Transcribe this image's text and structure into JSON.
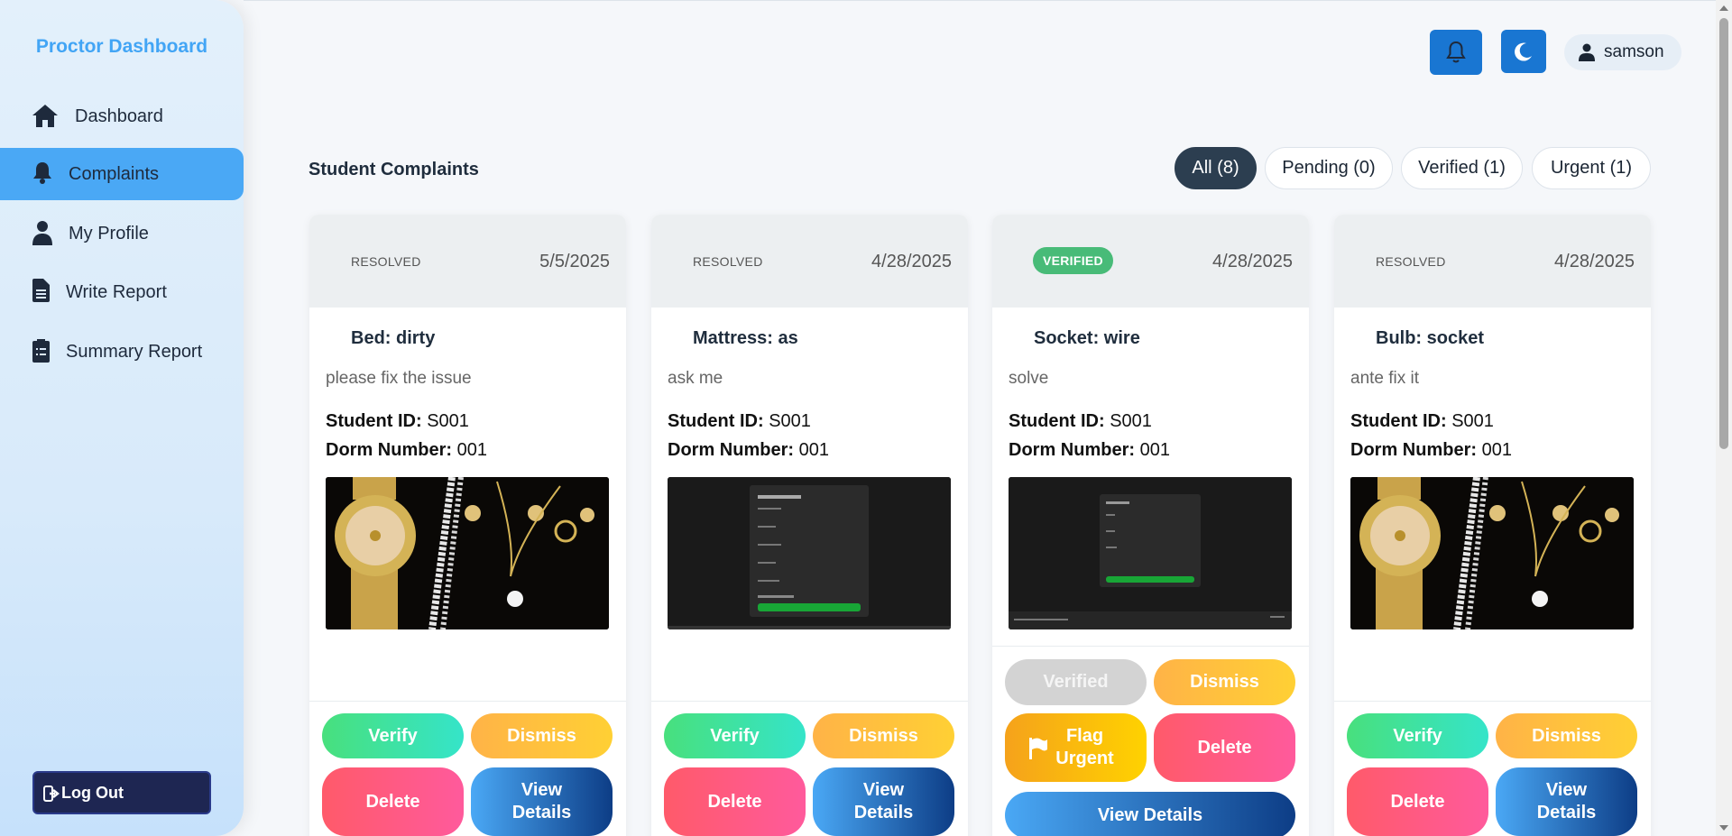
{
  "sidebar": {
    "brand": "Proctor Dashboard",
    "items": [
      {
        "label": "Dashboard",
        "icon": "home-icon"
      },
      {
        "label": "Complaints",
        "icon": "bell-icon",
        "active": true
      },
      {
        "label": "My Profile",
        "icon": "user-icon"
      },
      {
        "label": "Write Report",
        "icon": "file-icon"
      },
      {
        "label": "Summary Report",
        "icon": "clipboard-icon"
      }
    ],
    "logout_label": "Log Out"
  },
  "header": {
    "notifications_icon": "bell-icon",
    "theme_icon": "moon-icon",
    "user_name": "samson"
  },
  "main": {
    "title": "Student Complaints",
    "filters": [
      {
        "label": "All (8)",
        "active": true
      },
      {
        "label": "Pending (0)"
      },
      {
        "label": "Verified (1)"
      },
      {
        "label": "Urgent (1)"
      }
    ],
    "cards": [
      {
        "status": "RESOLVED",
        "date": "5/5/2025",
        "title": "Bed: dirty",
        "description": "please fix the issue",
        "student_id_label": "Student ID:",
        "student_id": "S001",
        "dorm_label": "Dorm Number:",
        "dorm": "001",
        "image": "jewelry-photo",
        "buttons": {
          "verify": "Verify",
          "dismiss": "Dismiss",
          "delete": "Delete",
          "view": "View Details"
        }
      },
      {
        "status": "RESOLVED",
        "date": "4/28/2025",
        "title": "Mattress: as",
        "description": "ask me",
        "student_id_label": "Student ID:",
        "student_id": "S001",
        "dorm_label": "Dorm Number:",
        "dorm": "001",
        "image": "create-account-screenshot",
        "buttons": {
          "verify": "Verify",
          "dismiss": "Dismiss",
          "delete": "Delete",
          "view": "View Details"
        }
      },
      {
        "status": "VERIFIED",
        "date": "4/28/2025",
        "title": "Socket: wire",
        "description": "solve",
        "student_id_label": "Student ID:",
        "student_id": "S001",
        "dorm_label": "Dorm Number:",
        "dorm": "001",
        "image": "contact-form-screenshot",
        "buttons": {
          "verified": "Verified",
          "dismiss": "Dismiss",
          "urgent": "Flag Urgent",
          "delete": "Delete",
          "view": "View Details"
        }
      },
      {
        "status": "RESOLVED",
        "date": "4/28/2025",
        "title": "Bulb: socket",
        "description": "ante fix it",
        "student_id_label": "Student ID:",
        "student_id": "S001",
        "dorm_label": "Dorm Number:",
        "dorm": "001",
        "image": "jewelry-photo",
        "buttons": {
          "verify": "Verify",
          "dismiss": "Dismiss",
          "delete": "Delete",
          "view": "View Details"
        }
      }
    ]
  },
  "colors": {
    "brand": "#42a5f5",
    "active_nav": "#4aa8f5",
    "header_button": "#1976d2",
    "verified_badge": "#48bb78",
    "filter_active": "#2c3e50"
  }
}
